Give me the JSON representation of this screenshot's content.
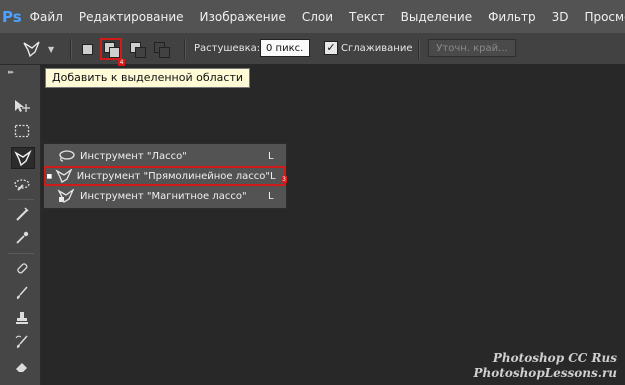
{
  "app": {
    "logo": "Ps"
  },
  "menu": [
    "Файл",
    "Редактирование",
    "Изображение",
    "Слои",
    "Текст",
    "Выделение",
    "Фильтр",
    "3D",
    "Просмотр"
  ],
  "options": {
    "feather_label": "Растушевка:",
    "feather_value": "0 пикс.",
    "antialias_label": "Сглаживание",
    "antialias_checked": true,
    "refine_edge_label": "Уточн. край...",
    "active_mode_badge": "4"
  },
  "tooltip": "Добавить к выделенной области",
  "flyout": {
    "items": [
      {
        "label": "Инструмент \"Лассо\"",
        "key": "L",
        "selected": false,
        "icon": "lasso-icon"
      },
      {
        "label": "Инструмент \"Прямолинейное лассо\"",
        "key": "L",
        "selected": true,
        "icon": "polygonal-lasso-icon"
      },
      {
        "label": "Инструмент \"Магнитное лассо\"",
        "key": "L",
        "selected": false,
        "icon": "magnetic-lasso-icon"
      }
    ],
    "badge": "3"
  },
  "tools": [
    "move-tool-icon",
    "marquee-tool-icon",
    "lasso-tool-icon",
    "quick-selection-tool-icon",
    "crop-tool-icon",
    "eyedropper-tool-icon",
    "healing-brush-tool-icon",
    "brush-tool-icon",
    "clone-stamp-tool-icon",
    "history-brush-tool-icon",
    "eraser-tool-icon"
  ],
  "watermark": {
    "line1": "Photoshop CC Rus",
    "line2": "PhotoshopLessons.ru"
  },
  "colors": {
    "menubar": "#535353",
    "optbar": "#424242",
    "canvas": "#282828",
    "highlight": "#d11a1a",
    "tooltip_bg": "#fffbd6",
    "logo": "#4aa3ff"
  }
}
